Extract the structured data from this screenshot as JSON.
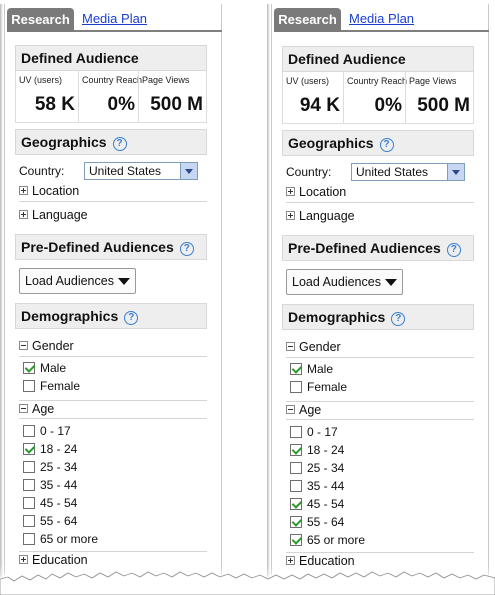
{
  "panels": [
    {
      "tabs": {
        "active": "Research",
        "other": "Media Plan"
      },
      "defined_audience": {
        "title": "Defined Audience",
        "stats": [
          {
            "label": "UV (users)",
            "value": "58 K"
          },
          {
            "label": "Country Reach",
            "value": "0%"
          },
          {
            "label": "Page Views",
            "value": "500 M"
          }
        ]
      },
      "geographics": {
        "title": "Geographics",
        "country_label": "Country:",
        "country_value": "United States",
        "location": "Location",
        "language": "Language"
      },
      "predefined": {
        "title": "Pre-Defined Audiences",
        "load_label": "Load Audiences"
      },
      "demographics": {
        "title": "Demographics",
        "gender_label": "Gender",
        "gender": [
          {
            "label": "Male",
            "checked": true
          },
          {
            "label": "Female",
            "checked": false
          }
        ],
        "age_label": "Age",
        "age": [
          {
            "label": "0 - 17",
            "checked": false
          },
          {
            "label": "18 - 24",
            "checked": true
          },
          {
            "label": "25 - 34",
            "checked": false
          },
          {
            "label": "35 - 44",
            "checked": false
          },
          {
            "label": "45 - 54",
            "checked": false
          },
          {
            "label": "55 - 64",
            "checked": false
          },
          {
            "label": "65 or more",
            "checked": false
          }
        ],
        "education": "Education"
      }
    },
    {
      "tabs": {
        "active": "Research",
        "other": "Media Plan"
      },
      "defined_audience": {
        "title": "Defined Audience",
        "stats": [
          {
            "label": "UV (users)",
            "value": "94 K"
          },
          {
            "label": "Country Reach",
            "value": "0%"
          },
          {
            "label": "Page Views",
            "value": "500 M"
          }
        ]
      },
      "geographics": {
        "title": "Geographics",
        "country_label": "Country:",
        "country_value": "United States",
        "location": "Location",
        "language": "Language"
      },
      "predefined": {
        "title": "Pre-Defined Audiences",
        "load_label": "Load Audiences"
      },
      "demographics": {
        "title": "Demographics",
        "gender_label": "Gender",
        "gender": [
          {
            "label": "Male",
            "checked": true
          },
          {
            "label": "Female",
            "checked": false
          }
        ],
        "age_label": "Age",
        "age": [
          {
            "label": "0 - 17",
            "checked": false
          },
          {
            "label": "18 - 24",
            "checked": true
          },
          {
            "label": "25 - 34",
            "checked": false
          },
          {
            "label": "35 - 44",
            "checked": false
          },
          {
            "label": "45 - 54",
            "checked": true
          },
          {
            "label": "55 - 64",
            "checked": true
          },
          {
            "label": "65 or more",
            "checked": true
          }
        ],
        "education": "Education"
      }
    }
  ],
  "icons": {
    "help": "help-circle-icon",
    "expand": "plus-box-icon",
    "collapse": "minus-box-icon",
    "dropdown": "chevron-down-icon"
  },
  "colors": {
    "tab_active": "#7a7a7a",
    "link": "#1a3fcf",
    "section_header_bg": "#eeeeee",
    "check_mark": "#2a9a2a",
    "help_icon": "#3a7fd0"
  }
}
